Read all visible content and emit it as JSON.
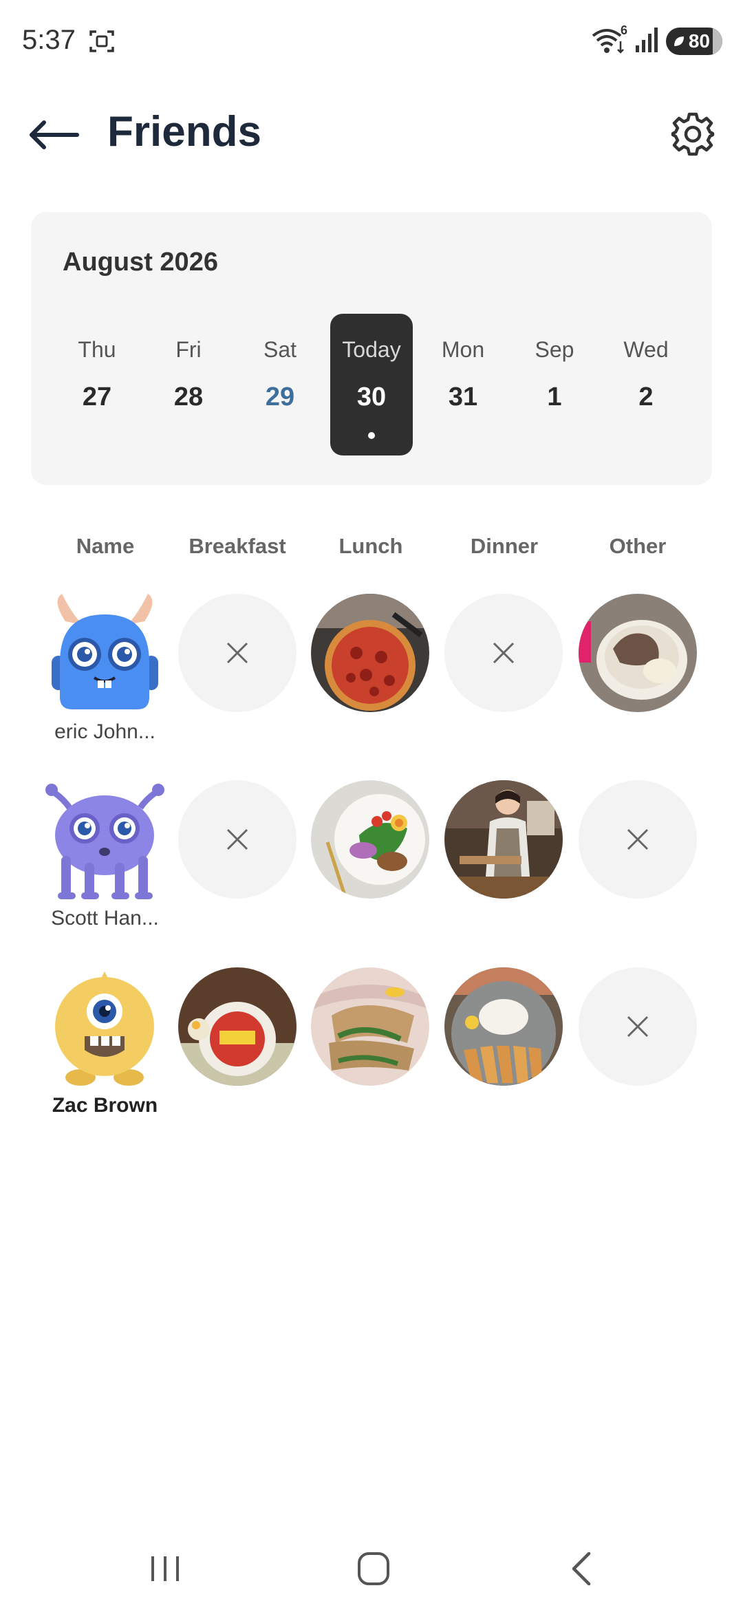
{
  "status_bar": {
    "time": "5:37",
    "wifi_badge": "6",
    "battery": "80"
  },
  "header": {
    "title": "Friends",
    "back_icon": "arrow-left-icon",
    "settings_icon": "gear-icon"
  },
  "calendar": {
    "month": "August 2026",
    "days": [
      {
        "dow": "Thu",
        "num": "27"
      },
      {
        "dow": "Fri",
        "num": "28"
      },
      {
        "dow": "Sat",
        "num": "29"
      },
      {
        "dow": "Today",
        "num": "30"
      },
      {
        "dow": "Mon",
        "num": "31"
      },
      {
        "dow": "Sep",
        "num": "1"
      },
      {
        "dow": "Wed",
        "num": "2"
      }
    ],
    "selected_index": 3,
    "accent_weekend": "#3d6e9c",
    "selected_bg": "#2f2f2f"
  },
  "table": {
    "columns": [
      "Name",
      "Breakfast",
      "Lunch",
      "Dinner",
      "Other"
    ],
    "rows": [
      {
        "name": "eric John...",
        "avatar": "blue-horned-monster-avatar",
        "meals": {
          "breakfast": "empty",
          "lunch": "pizza-photo",
          "dinner": "empty",
          "other": "dessert-cup-photo"
        }
      },
      {
        "name": "Scott Han...",
        "avatar": "purple-tentacle-monster-avatar",
        "meals": {
          "breakfast": "empty",
          "lunch": "salad-plate-photo",
          "dinner": "chef-serving-photo",
          "other": "empty"
        }
      },
      {
        "name": "Zac Brown",
        "avatar": "yellow-cyclops-monster-avatar",
        "meals": {
          "breakfast": "instant-noodle-cup-photo",
          "lunch": "wrap-sandwich-photo",
          "dinner": "tonkatsu-plate-photo",
          "other": "empty"
        }
      }
    ]
  }
}
